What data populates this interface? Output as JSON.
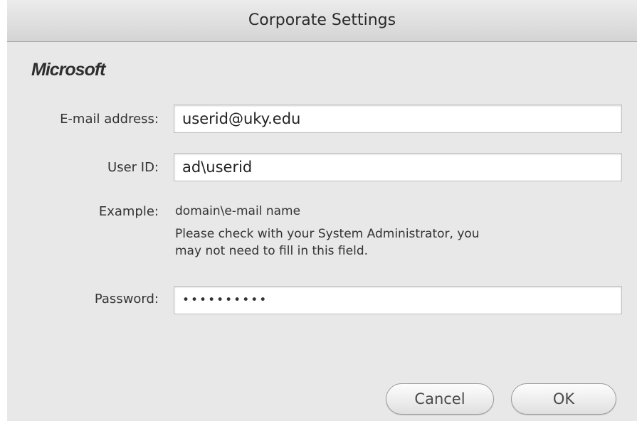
{
  "window": {
    "title": "Corporate Settings"
  },
  "logo": {
    "text": "Microsoft"
  },
  "form": {
    "email": {
      "label": "E-mail address:",
      "value": "userid@uky.edu"
    },
    "userid": {
      "label": "User ID:",
      "value": "ad\\userid"
    },
    "example": {
      "label": "Example:",
      "value": "domain\\e-mail name"
    },
    "note": {
      "line1": "Please check with your System Administrator, you",
      "line2": "may not need to fill in this field."
    },
    "password": {
      "label": "Password:",
      "value": "••••••••••"
    }
  },
  "buttons": {
    "cancel": "Cancel",
    "ok": "OK"
  }
}
